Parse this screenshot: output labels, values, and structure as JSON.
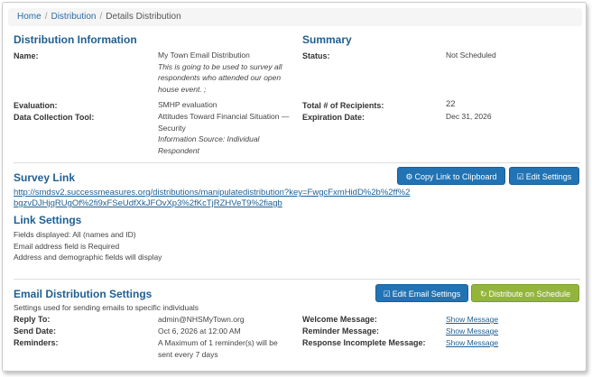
{
  "breadcrumb": {
    "home": "Home",
    "distribution": "Distribution",
    "current": "Details Distribution",
    "separator": "/"
  },
  "distribution_info": {
    "heading": "Distribution Information",
    "name_label": "Name:",
    "name_value": "My Town Email Distribution",
    "description": "This is going to be used to survey all respondents who attended our open house event. ;",
    "evaluation_label": "Evaluation:",
    "evaluation_value": "SMHP evaluation",
    "tool_label": "Data Collection Tool:",
    "tool_value": "Attitudes Toward Financial Situation — Security",
    "tool_source": "Information Source: Individual Respondent"
  },
  "summary": {
    "heading": "Summary",
    "status_label": "Status:",
    "status_value": "Not Scheduled",
    "recipients_label": "Total # of Recipients:",
    "recipients_value": "22",
    "expiration_label": "Expiration Date:",
    "expiration_value": "Dec 31, 2026"
  },
  "survey_link": {
    "heading": "Survey Link",
    "url": "http://smdsv2.successmeasures.org/distributions/manipulatedistribution?key=FwgcFxmHidD%2b%2ff%2bgzvDJHjqRUgOf%2fi9xFSeUdfXkJFOvXp3%2fKcTjRZHVeT9%2fiagb",
    "copy_button": "Copy Link to Clipboard",
    "edit_button": "Edit Settings"
  },
  "link_settings": {
    "heading": "Link Settings",
    "lines": [
      "Fields displayed: All (names and ID)",
      "Email address field is Required",
      "Address and demographic fields will display"
    ]
  },
  "email_settings": {
    "heading": "Email Distribution Settings",
    "subtitle": "Settings used for sending emails to specific individuals",
    "edit_button": "Edit Email Settings",
    "schedule_button": "Distribute on Schedule",
    "reply_label": "Reply To:",
    "reply_value": "admin@NHSMyTown.org",
    "send_label": "Send Date:",
    "send_value": "Oct 6, 2026 at 12:00 AM",
    "reminders_label": "Reminders:",
    "reminders_value": "A Maximum of 1 reminder(s) will be sent every 7 days",
    "welcome_label": "Welcome Message:",
    "welcome_value": "Show Message",
    "reminder_label": "Reminder Message:",
    "reminder_value": "Show Message",
    "incomplete_label": "Response Incomplete Message:",
    "incomplete_value": "Show Message"
  },
  "colors": {
    "heading": "#1f5f92",
    "primary_button": "#2173b3",
    "success_button": "#94b53c"
  },
  "icons": {
    "copy": "gear-icon",
    "edit": "edit-icon",
    "schedule": "refresh-icon"
  }
}
